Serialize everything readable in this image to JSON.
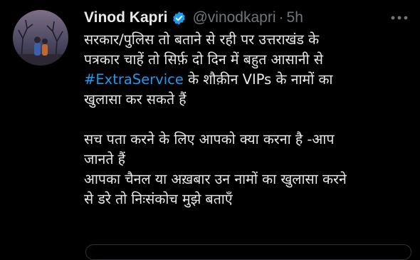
{
  "tweet": {
    "author_name": "Vinod Kapri",
    "handle": "@vinodkapri",
    "separator": "·",
    "time": "5h",
    "lines": [
      "सरकार/पुलिस तो बताने से रही पर उत्तराखंड के",
      "पत्रकार चाहें तो सिर्फ़ दो दिन में बहुत आसानी से"
    ],
    "hashtag": "#ExtraService",
    "hashtag_line_rest": " के शौक़ीन VIPs के नामों का",
    "lines2": [
      "खुलासा कर सकते हैं",
      "",
      "सच पता करने के लिए आपको क्या करना है -आप",
      "जानते हैं",
      "आपका चैनल या अख़बार उन नामों का खुलासा करने",
      "से डरे तो निःसंकोच मुझे बताएँ"
    ]
  },
  "colors": {
    "background": "#000000",
    "text": "#e7e9ea",
    "secondary": "#71767b",
    "link": "#1d9bf0",
    "verified": "#1d9bf0"
  },
  "icons": {
    "verified": "verified-badge-icon",
    "more": "more-dots-icon"
  }
}
